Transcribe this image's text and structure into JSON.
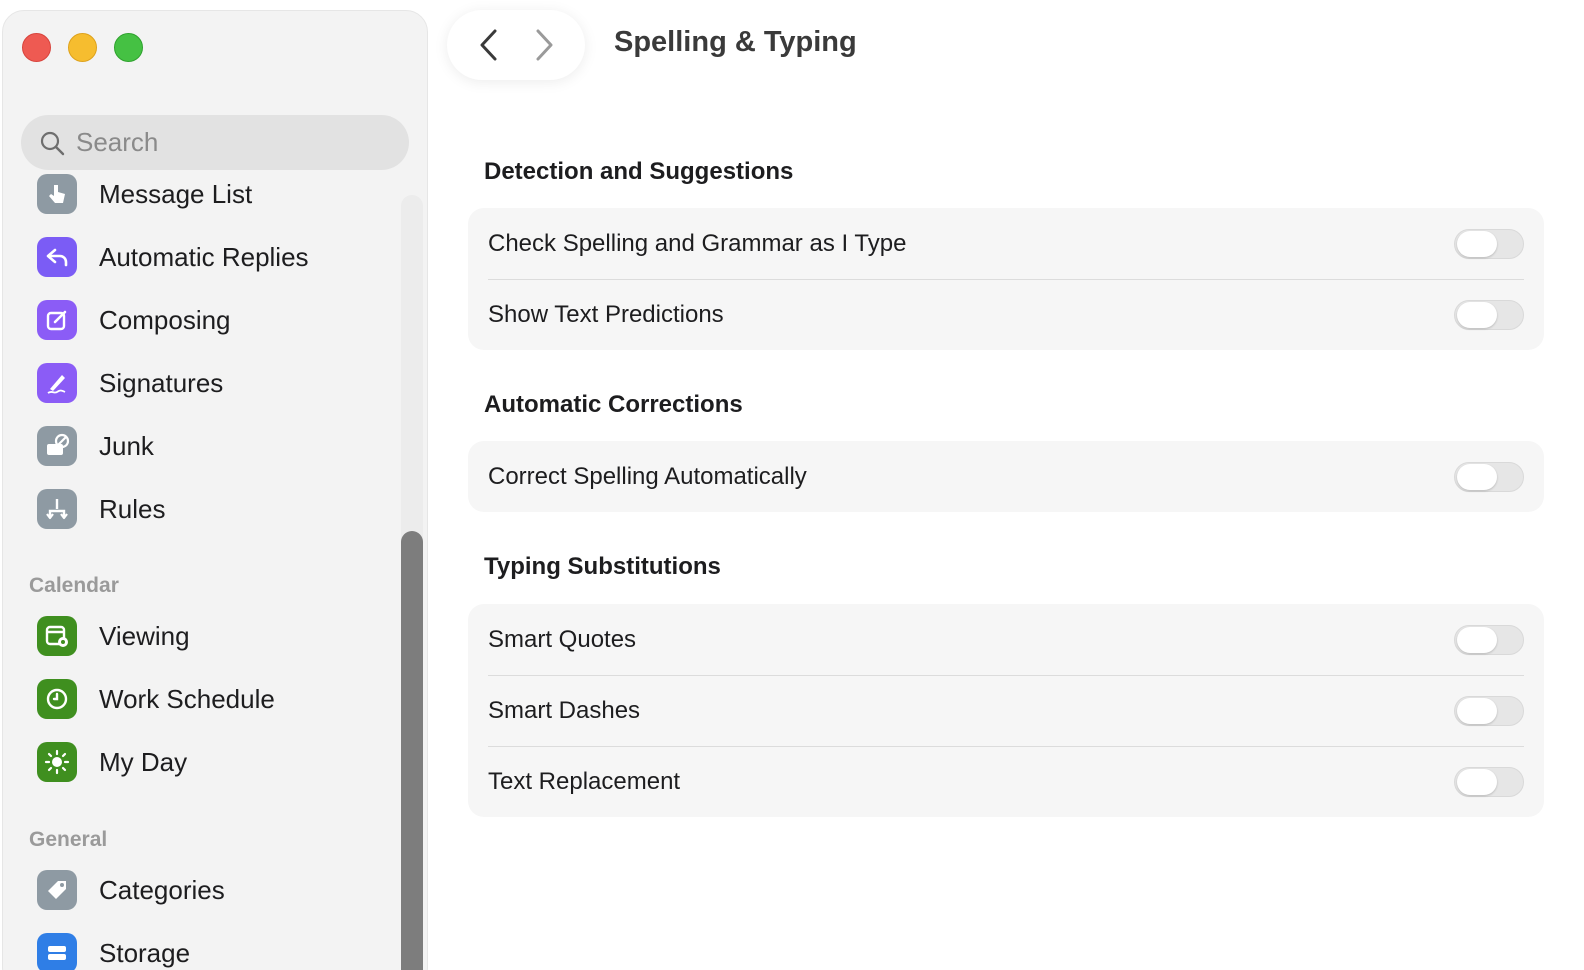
{
  "window": {
    "title": "Spelling & Typing"
  },
  "search": {
    "placeholder": "Search"
  },
  "sidebar": {
    "mail_items": [
      {
        "label": "Message List",
        "icon": "hand-pointer-icon",
        "color": "#8e9aa3"
      },
      {
        "label": "Automatic Replies",
        "icon": "reply-arrow-icon",
        "color": "#7b5cf5"
      },
      {
        "label": "Composing",
        "icon": "compose-icon",
        "color": "#8b5cf6"
      },
      {
        "label": "Signatures",
        "icon": "signature-icon",
        "color": "#8b5cf6"
      },
      {
        "label": "Junk",
        "icon": "junk-icon",
        "color": "#8e9aa3"
      },
      {
        "label": "Rules",
        "icon": "rules-icon",
        "color": "#8e9aa3"
      }
    ],
    "calendar_section": "Calendar",
    "calendar_items": [
      {
        "label": "Viewing",
        "icon": "calendar-gear-icon",
        "color": "#3f8f1f"
      },
      {
        "label": "Work Schedule",
        "icon": "clock-icon",
        "color": "#3f8f1f"
      },
      {
        "label": "My Day",
        "icon": "sun-icon",
        "color": "#3f8f1f"
      }
    ],
    "general_section": "General",
    "general_items": [
      {
        "label": "Categories",
        "icon": "tag-icon",
        "color": "#8e9aa3"
      },
      {
        "label": "Storage",
        "icon": "storage-icon",
        "color": "#2f7ee6"
      }
    ]
  },
  "content": {
    "detection": {
      "title": "Detection and Suggestions",
      "rows": [
        {
          "label": "Check Spelling and Grammar as I Type",
          "on": false
        },
        {
          "label": "Show Text Predictions",
          "on": false
        }
      ]
    },
    "corrections": {
      "title": "Automatic Corrections",
      "rows": [
        {
          "label": "Correct Spelling Automatically",
          "on": false
        }
      ]
    },
    "substitutions": {
      "title": "Typing Substitutions",
      "rows": [
        {
          "label": "Smart Quotes",
          "on": false
        },
        {
          "label": "Smart Dashes",
          "on": false
        },
        {
          "label": "Text Replacement",
          "on": false
        }
      ]
    }
  }
}
